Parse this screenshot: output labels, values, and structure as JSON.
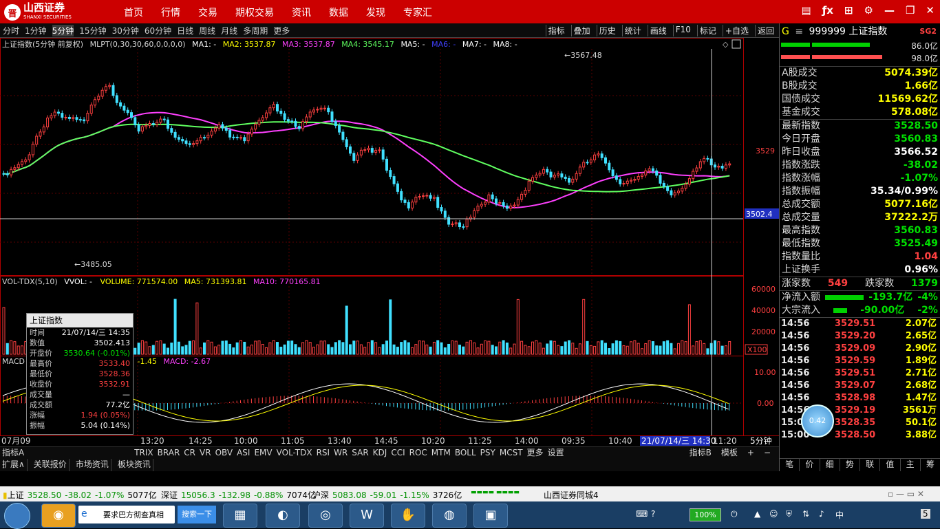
{
  "app": {
    "name": "山西证券",
    "subname": "SHANXI SECURITIES"
  },
  "menu": [
    "首页",
    "行情",
    "交易",
    "期权交易",
    "资讯",
    "数据",
    "发现",
    "专家汇"
  ],
  "periods": [
    "分时",
    "1分钟",
    "5分钟",
    "15分钟",
    "30分钟",
    "60分钟",
    "日线",
    "周线",
    "月线",
    "多周期",
    "更多"
  ],
  "selected_period": "5分钟",
  "tools": [
    "指标",
    "叠加",
    "历史",
    "统计",
    "画线",
    "F10",
    "标记",
    "+自选",
    "返回"
  ],
  "main_chart": {
    "title": "上证指数(5分钟 前复权)",
    "indicator": "MLPT(0,30,30,60,0,0,0,0)",
    "ma_labels": [
      "MA1: -",
      "MA2: 3537.87",
      "MA3: 3537.87",
      "MA4: 3545.17",
      "MA5: -",
      "MA6: -",
      "MA7: -",
      "MA8: -"
    ],
    "ma_colors": [
      "#ffffff",
      "#ffff00",
      "#ff40ff",
      "#60ff60",
      "#ffffff",
      "#4040ff",
      "#ffffff",
      "#ffffff"
    ],
    "high_label": "3567.48",
    "low_label": "3485.05",
    "price_tick": "3529",
    "cursor_price": "3502.4"
  },
  "volume_chart": {
    "title": "VOL-TDX(5,10)",
    "labels": [
      "VVOL: -",
      "VOLUME: 771574.00",
      "MA5: 731393.81",
      "MA10: 770165.81"
    ],
    "label_colors": [
      "#ffffff",
      "#ffff00",
      "#ffff00",
      "#ff40ff"
    ],
    "ticks": [
      "60000",
      "40000",
      "20000"
    ],
    "unit": "X100"
  },
  "macd_chart": {
    "title": "MACD",
    "labels": [
      "-1.45",
      "MACD: -2.67"
    ],
    "label_colors": [
      "#ffff00",
      "#ff40ff"
    ],
    "ticks": [
      "10.00",
      "0.00"
    ]
  },
  "time_axis": [
    "07月09",
    "13:20",
    "14:25",
    "10:00",
    "11:05",
    "13:40",
    "14:45",
    "10:20",
    "11:25",
    "14:00",
    "09:35",
    "10:40",
    "21/07/14/三 14:30",
    "11:20"
  ],
  "time_axis_period": "5分钟",
  "info_box": {
    "title": "上证指数",
    "rows": [
      {
        "k": "时间",
        "v": "21/07/14/三 14:35",
        "c": "wh"
      },
      {
        "k": "数值",
        "v": "3502.413",
        "c": "wh"
      },
      {
        "k": "开盘价",
        "v": "3530.64 (-0.01%)",
        "c": "g"
      },
      {
        "k": "最高价",
        "v": "3533.40",
        "c": "r"
      },
      {
        "k": "最低价",
        "v": "3528.36",
        "c": "r"
      },
      {
        "k": "收盘价",
        "v": "3532.91",
        "c": "r"
      },
      {
        "k": "成交量",
        "v": "—",
        "c": "wh"
      },
      {
        "k": "成交额",
        "v": "77.2亿",
        "c": "wh"
      },
      {
        "k": "涨幅",
        "v": "1.94 (0.05%)",
        "c": "r"
      },
      {
        "k": "振幅",
        "v": "5.04 (0.14%)",
        "c": "wh"
      }
    ]
  },
  "indicator_tabs": [
    "指标A",
    "TRIX",
    "BRAR",
    "CR",
    "VR",
    "OBV",
    "ASI",
    "EMV",
    "VOL-TDX",
    "RSI",
    "WR",
    "SAR",
    "KDJ",
    "CCI",
    "ROC",
    "MTM",
    "BOLL",
    "PSY",
    "MCST",
    "更多",
    "设置"
  ],
  "indicator_tabs_right": [
    "指标B",
    "模板",
    "+",
    "−"
  ],
  "bottom_tabs": [
    "扩展∧",
    "关联报价",
    "市场资讯",
    "板块资讯"
  ],
  "right_panel": {
    "header_prefix": "G",
    "code": "999999",
    "name": "上证指数",
    "badge": "SG2",
    "bar_values": [
      "86.0亿",
      "98.0亿"
    ],
    "turnover_rows": [
      {
        "k": "A股成交",
        "v": "5074.39亿",
        "c": "yl"
      },
      {
        "k": "B股成交",
        "v": "1.66亿",
        "c": "yl"
      },
      {
        "k": "国债成交",
        "v": "11569.62亿",
        "c": "yl"
      },
      {
        "k": "基金成交",
        "v": "578.08亿",
        "c": "yl"
      }
    ],
    "stats_rows": [
      {
        "k": "最新指数",
        "v": "3528.50",
        "c": "dn"
      },
      {
        "k": "今日开盘",
        "v": "3560.83",
        "c": "dn"
      },
      {
        "k": "昨日收盘",
        "v": "3566.52",
        "c": "wh"
      },
      {
        "k": "指数涨跌",
        "v": "-38.02",
        "c": "dn"
      },
      {
        "k": "指数涨幅",
        "v": "-1.07%",
        "c": "dn"
      },
      {
        "k": "指数振幅",
        "v": "35.34/0.99%",
        "c": "wh"
      },
      {
        "k": "总成交额",
        "v": "5077.16亿",
        "c": "yl"
      },
      {
        "k": "总成交量",
        "v": "37222.2万",
        "c": "yl"
      },
      {
        "k": "最高指数",
        "v": "3560.83",
        "c": "dn"
      },
      {
        "k": "最低指数",
        "v": "3525.49",
        "c": "dn"
      },
      {
        "k": "指数量比",
        "v": "1.04",
        "c": "up"
      },
      {
        "k": "上证换手",
        "v": "0.96%",
        "c": "wh"
      }
    ],
    "counts": {
      "up_label": "涨家数",
      "up": "549",
      "down_label": "跌家数",
      "down": "1379"
    },
    "flows": [
      {
        "k": "净流入额",
        "v": "-193.7亿",
        "p": "-4%"
      },
      {
        "k": "大宗流入",
        "v": "-90.00亿",
        "p": "-2%"
      }
    ],
    "ticks": [
      {
        "t": "14:56",
        "p": "3529.51",
        "v": "2.07亿"
      },
      {
        "t": "14:56",
        "p": "3529.20",
        "v": "2.65亿"
      },
      {
        "t": "14:56",
        "p": "3529.09",
        "v": "2.90亿"
      },
      {
        "t": "14:56",
        "p": "3529.59",
        "v": "1.89亿"
      },
      {
        "t": "14:56",
        "p": "3529.51",
        "v": "2.71亿"
      },
      {
        "t": "14:56",
        "p": "3529.07",
        "v": "2.68亿"
      },
      {
        "t": "14:56",
        "p": "3528.98",
        "v": "1.47亿"
      },
      {
        "t": "14:56",
        "p": "3529.19",
        "v": "3561万"
      },
      {
        "t": "15:00",
        "p": "3528.35",
        "v": "50.1亿"
      },
      {
        "t": "15:00",
        "p": "3528.50",
        "v": "3.88亿"
      }
    ],
    "bottom": [
      "笔",
      "价",
      "细",
      "势",
      "联",
      "值",
      "主",
      "筹"
    ]
  },
  "float_ball": "0.42",
  "statusbar": [
    {
      "name": "上证",
      "price": "3528.50",
      "chg": "-38.02",
      "pct": "-1.07%",
      "amt": "5077亿"
    },
    {
      "name": "深证",
      "price": "15056.3",
      "chg": "-132.98",
      "pct": "-0.88%",
      "amt": "7074亿"
    },
    {
      "name": "沪深",
      "price": "5083.08",
      "chg": "-59.01",
      "pct": "-1.15%",
      "amt": "3726亿"
    }
  ],
  "statusbar_right": "山西证券同城4",
  "taskbar": {
    "search_placeholder": "要求巴方彻查真相",
    "search_button": "搜索一下",
    "battery": "100%",
    "notify": "5"
  }
}
